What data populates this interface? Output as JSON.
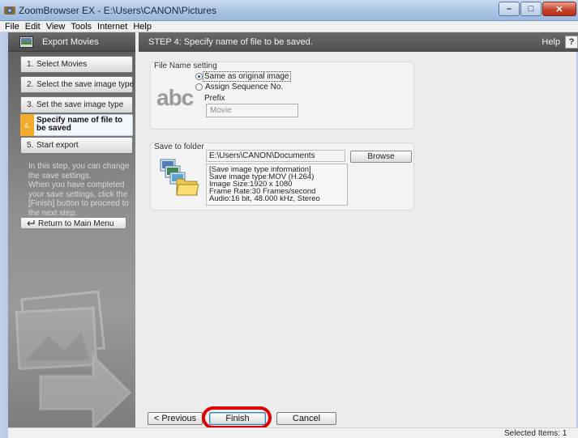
{
  "window": {
    "title": "ZoomBrowser EX - E:\\Users\\CANON\\Pictures"
  },
  "menu": [
    "File",
    "Edit",
    "View",
    "Tools",
    "Internet",
    "Help"
  ],
  "left_panel": {
    "header": "Export Movies",
    "steps": [
      {
        "num": "1.",
        "label": "Select Movies"
      },
      {
        "num": "2.",
        "label": "Select the save image type"
      },
      {
        "num": "3.",
        "label": "Set the save image type"
      },
      {
        "num": "4.",
        "label": "Specify name of file to be saved"
      },
      {
        "num": "5.",
        "label": "Start export"
      }
    ],
    "active_step": 4,
    "help_text": "In this step, you can change the save settings.\nWhen you have completed your save settings, click the [Finish] button to proceed to the next step.",
    "return_button": "Return to Main Menu"
  },
  "step_header": {
    "title": "STEP 4: Specify name of file to be saved.",
    "help": "Help",
    "help_icon_glyph": "?"
  },
  "file_name_setting": {
    "title": "File Name setting",
    "icon_text": "abc",
    "options": [
      {
        "label": "Same as original image",
        "checked": true
      },
      {
        "label": "Assign Sequence No.",
        "checked": false
      }
    ],
    "prefix_label": "Prefix",
    "prefix_value": "Movie"
  },
  "save_to_folder": {
    "title": "Save to folder",
    "path": "E:\\Users\\CANON\\Documents",
    "browse_button": "Browse",
    "info_lines": [
      "[Save image type information]",
      "Save image type:MOV (H.264)",
      "Image Size:1920 x 1080",
      "Frame Rate:30 Frames/second",
      "Audio:16 bit, 48.000 kHz, Stereo"
    ]
  },
  "buttons": {
    "previous": "< Previous",
    "finish": "Finish",
    "cancel": "Cancel"
  },
  "status": {
    "selected_items": "Selected Items: 1"
  },
  "colors": {
    "active_step_accent": "#f2ab2b",
    "highlight_ring": "#e00000"
  }
}
